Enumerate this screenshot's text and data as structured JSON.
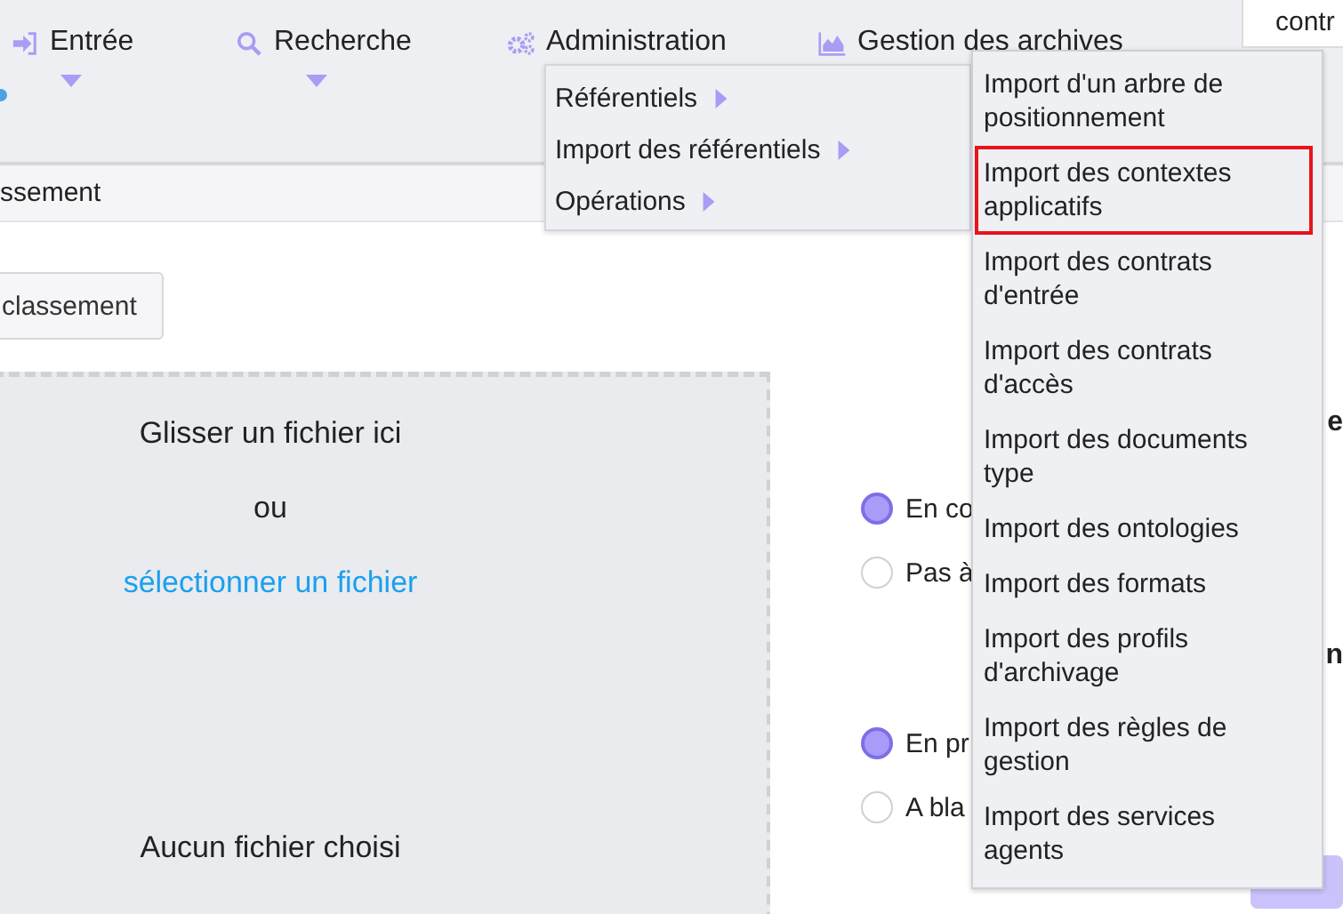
{
  "nav_items": [
    {
      "label": "Entrée",
      "kind": "login",
      "caret": true
    },
    {
      "label": "Recherche",
      "kind": "search",
      "caret": true
    },
    {
      "label": "Administration",
      "kind": "gears",
      "caret": false
    },
    {
      "label": "Gestion des archives",
      "kind": "chart",
      "caret": false
    }
  ],
  "top_tab": {
    "label": "contr"
  },
  "breadcrumb": {
    "label": "ssement"
  },
  "classement_button": {
    "label": "classement"
  },
  "dropzone": {
    "hint": "Glisser un fichier ici",
    "or": "ou",
    "link": "sélectionner un fichier",
    "status": "Aucun fichier choisi"
  },
  "sections": [
    {
      "heading": "e",
      "options": [
        {
          "label": "En co",
          "selected": true
        },
        {
          "label": "Pas à",
          "selected": false
        }
      ]
    },
    {
      "heading": "n",
      "options": [
        {
          "label": "En pr",
          "selected": true
        },
        {
          "label": "A bla",
          "selected": false
        }
      ]
    }
  ],
  "admin_menu": {
    "items": [
      {
        "label": "Référentiels",
        "submenu": true
      },
      {
        "label": "Import des référentiels",
        "submenu": true
      },
      {
        "label": "Opérations",
        "submenu": true
      }
    ]
  },
  "import_submenu": {
    "items": [
      {
        "label": "Import d'un arbre de positionnement",
        "selected": false
      },
      {
        "label": "Import des contextes applicatifs",
        "selected": true
      },
      {
        "label": "Import des contrats d'entrée",
        "selected": false
      },
      {
        "label": "Import des contrats d'accès",
        "selected": false
      },
      {
        "label": "Import des documents type",
        "selected": false
      },
      {
        "label": "Import des ontologies",
        "selected": false
      },
      {
        "label": "Import des formats",
        "selected": false
      },
      {
        "label": "Import des profils d'archivage",
        "selected": false
      },
      {
        "label": "Import des règles de gestion",
        "selected": false
      },
      {
        "label": "Import des services agents",
        "selected": false
      }
    ]
  }
}
